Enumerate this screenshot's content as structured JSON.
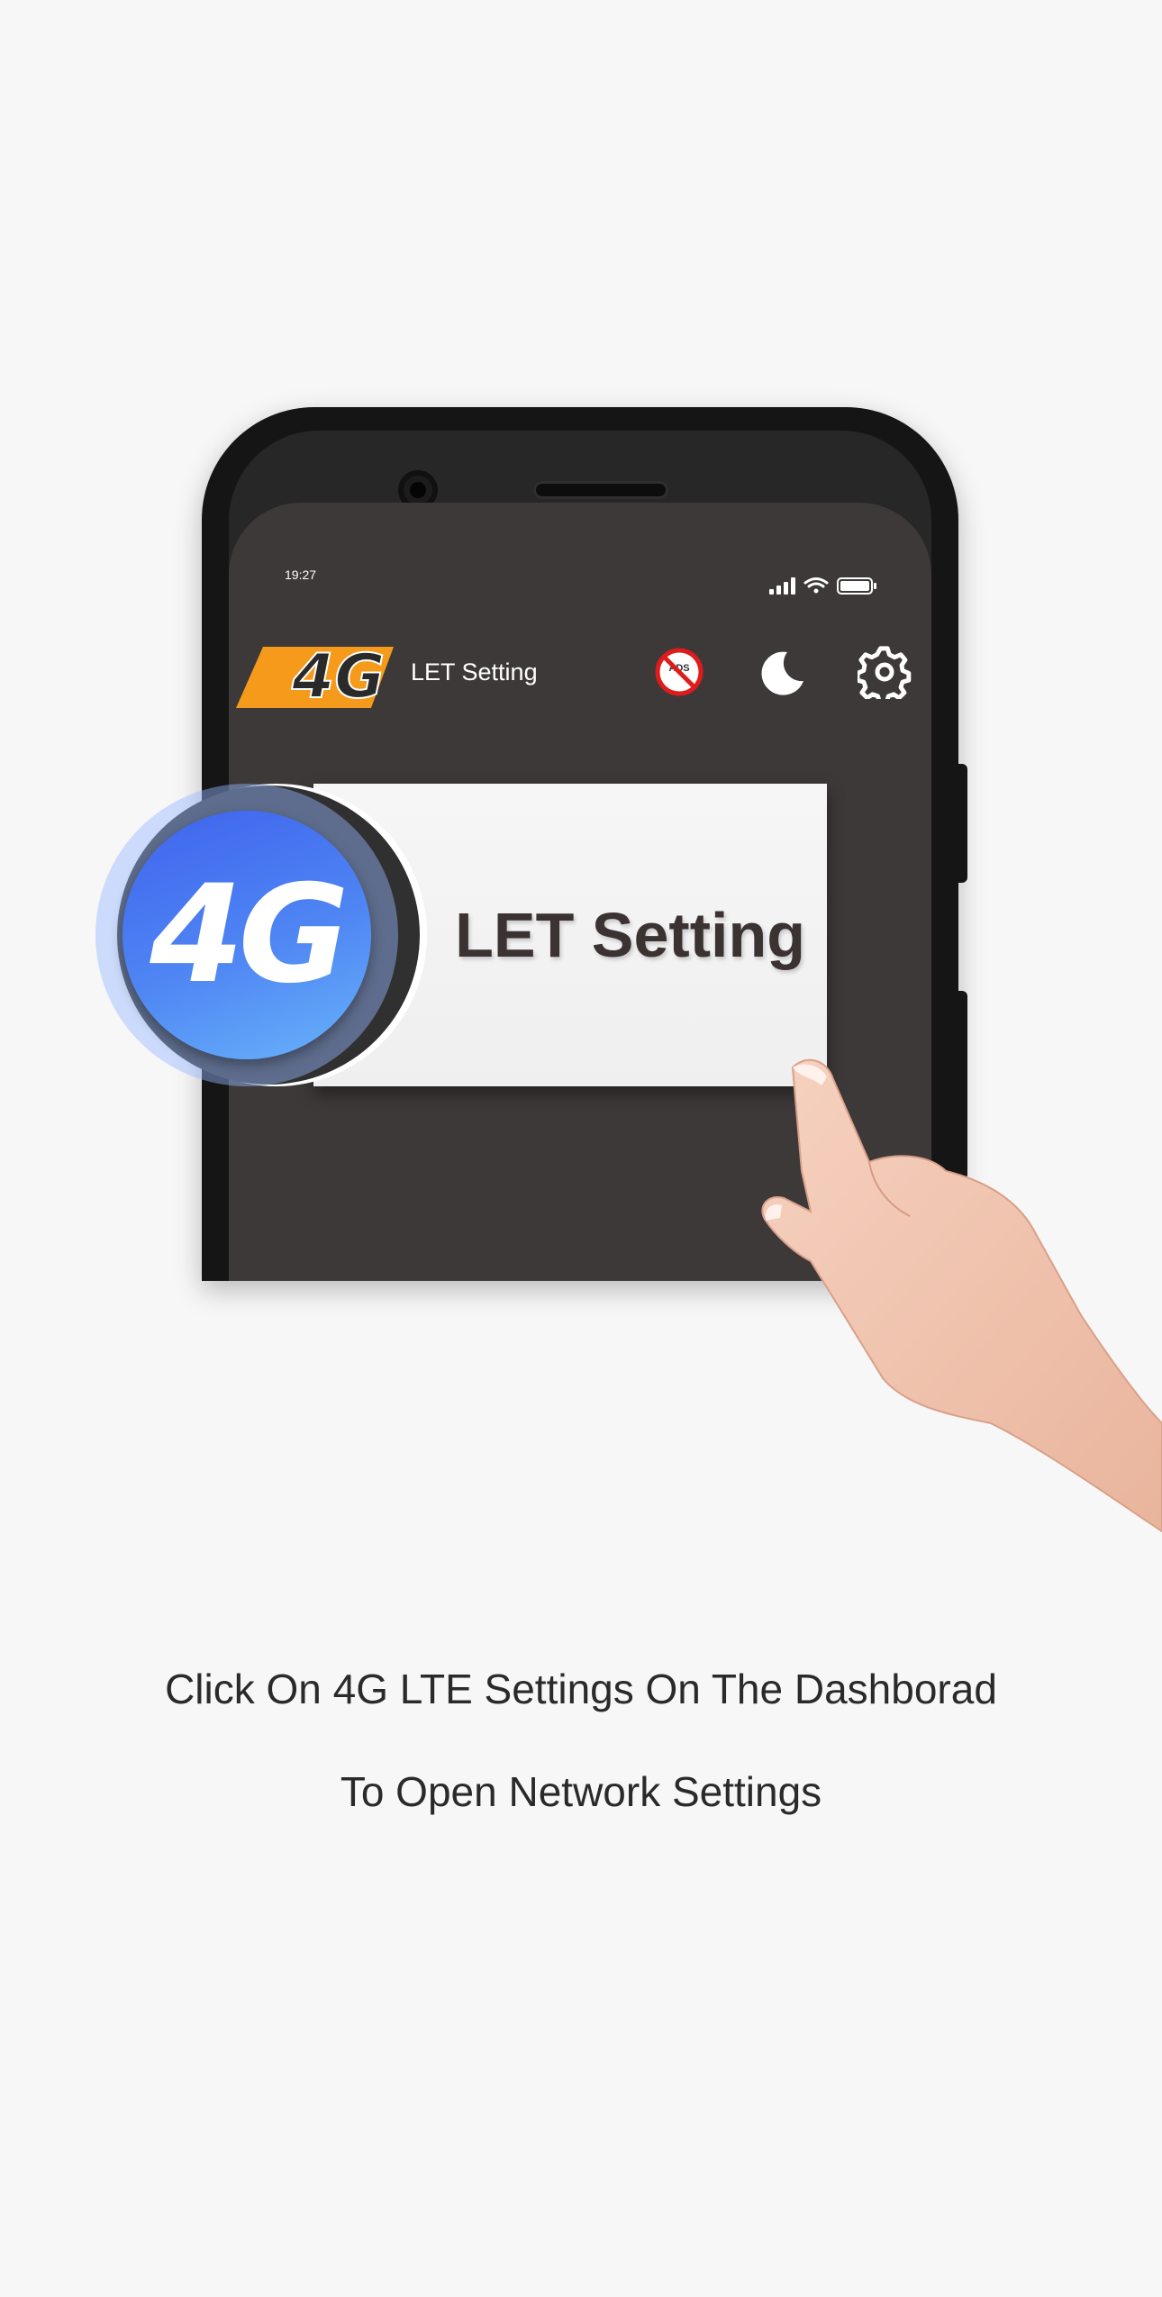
{
  "status_bar": {
    "time": "19:27",
    "icons": [
      "signal-icon",
      "wifi-icon",
      "battery-icon"
    ]
  },
  "app_header": {
    "logo_text": "4G",
    "title": "LET Setting",
    "icons": [
      "no-ads-icon",
      "night-mode-icon",
      "settings-gear-icon"
    ],
    "no_ads_label": "ADS"
  },
  "lte_card": {
    "badge_text": "4G",
    "title": "LET Setting"
  },
  "caption": {
    "line1": "Click On 4G LTE Settings On The Dashborad",
    "line2": "To Open Network Settings"
  },
  "colors": {
    "page_bg": "#f7f7f7",
    "screen_bg": "#3d3939",
    "logo_orange": "#f59a1b",
    "badge_blue_start": "#3f63ee",
    "badge_blue_end": "#68b3fb",
    "no_ads_red": "#e01b1b"
  }
}
